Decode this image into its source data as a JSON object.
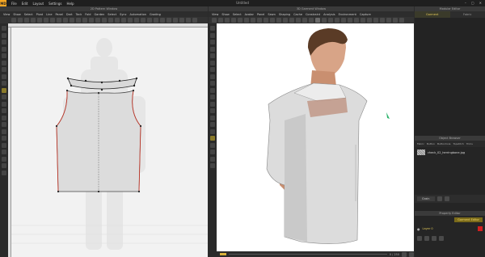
{
  "app": {
    "logo": "MD",
    "title": "Untitled"
  },
  "menu": [
    "File",
    "Edit",
    "Layout",
    "Settings",
    "Help"
  ],
  "window_controls": [
    "–",
    "▢",
    "✕"
  ],
  "panel2d": {
    "header": "2D Pattern Window",
    "menu": [
      "View",
      "Show",
      "Select",
      "Pivot",
      "Line",
      "Panel",
      "Dart",
      "Tack",
      "Fold",
      "Garden",
      "Select",
      "Sync",
      "Automation",
      "Grading"
    ]
  },
  "panel3d": {
    "header": "3D Garment Window",
    "menu": [
      "View",
      "Show",
      "Select",
      "Avatar",
      "Panel",
      "Sewn",
      "Shaping",
      "Cache",
      "Constraint",
      "Analysis",
      "Environment",
      "Capture"
    ]
  },
  "library": {
    "header": "Modular Editor",
    "tabs": [
      "Garment",
      "Fabric"
    ]
  },
  "object_browser": {
    "header": "Object Browser",
    "tabs": [
      "Fabric",
      "Button",
      "Buttonhole",
      "Topstitch",
      "Trims"
    ],
    "item": "check_02_herringbone.jpg"
  },
  "inspector": {
    "select_label": "Grain",
    "header": "Property Editor",
    "tab_active": "Garment Editor",
    "row_label": "Layer 0"
  },
  "timeline": {
    "readout": "0 / 250"
  }
}
